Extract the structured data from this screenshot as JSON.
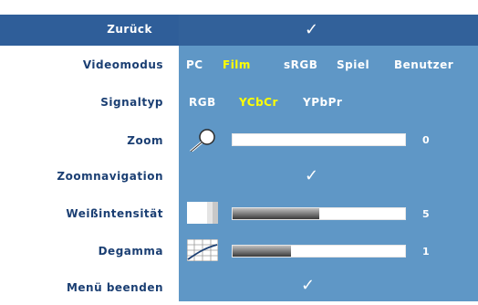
{
  "menu": {
    "back": {
      "label": "Zurück"
    },
    "video_mode": {
      "label": "Videomodus",
      "options": [
        "PC",
        "Film",
        "sRGB",
        "Spiel",
        "Benutzer"
      ],
      "selected": "Film"
    },
    "signal_type": {
      "label": "Signaltyp",
      "options": [
        "RGB",
        "YCbCr",
        "YPbPr"
      ],
      "selected": "YCbCr"
    },
    "zoom": {
      "label": "Zoom",
      "value": "0",
      "level": 0
    },
    "zoom_navigation": {
      "label": "Zoomnavigation"
    },
    "white_intensity": {
      "label": "Weißintensität",
      "value": "5",
      "level": 0.5
    },
    "degamma": {
      "label": "Degamma",
      "value": "1",
      "level": 0.34
    },
    "exit_menu": {
      "label": "Menü beenden"
    }
  },
  "colors": {
    "panel_blue": "#5f97c6",
    "header_blue": "#32619a",
    "label_navy": "#1b3f73",
    "selected_yellow": "#ffff00"
  }
}
